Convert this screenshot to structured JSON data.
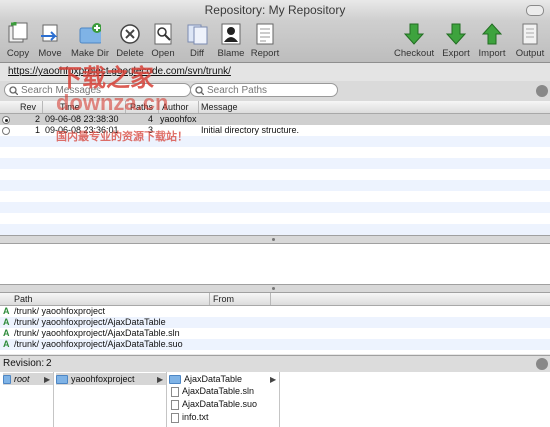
{
  "window": {
    "title": "Repository: My Repository"
  },
  "toolbar": {
    "left": [
      {
        "label": "Copy",
        "icon": "copy-icon"
      },
      {
        "label": "Move",
        "icon": "move-icon"
      },
      {
        "label": "Make Dir",
        "icon": "make-dir-icon"
      },
      {
        "label": "Delete",
        "icon": "delete-icon"
      },
      {
        "label": "Open",
        "icon": "open-icon"
      },
      {
        "label": "Diff",
        "icon": "diff-icon"
      },
      {
        "label": "Blame",
        "icon": "blame-icon"
      },
      {
        "label": "Report",
        "icon": "report-icon"
      }
    ],
    "right": [
      {
        "label": "Checkout",
        "icon": "checkout-icon"
      },
      {
        "label": "Export",
        "icon": "export-icon"
      },
      {
        "label": "Import",
        "icon": "import-icon"
      },
      {
        "label": "Output",
        "icon": "output-icon"
      }
    ]
  },
  "repo_url": "https://yaoohfoxproject.googlecode.com/svn/trunk/",
  "search": {
    "messages_placeholder": "Search Messages",
    "paths_placeholder": "Search Paths"
  },
  "log": {
    "columns": [
      "Rev",
      "Time",
      "Paths",
      "Author",
      "Message"
    ],
    "rows": [
      {
        "rev": "2",
        "time": "09-06-08 23:38:30",
        "paths": "4",
        "author": "yaoohfox",
        "message": "",
        "selected": true
      },
      {
        "rev": "1",
        "time": "09-06-08 23:36:01",
        "paths": "3",
        "author": "",
        "message": "Initial directory structure.",
        "selected": false
      }
    ]
  },
  "paths": {
    "columns": [
      "Path",
      "From"
    ],
    "rows": [
      {
        "action": "A",
        "path": "/trunk/ yaoohfoxproject"
      },
      {
        "action": "A",
        "path": "/trunk/ yaoohfoxproject/AjaxDataTable"
      },
      {
        "action": "A",
        "path": "/trunk/ yaoohfoxproject/AjaxDataTable.sln"
      },
      {
        "action": "A",
        "path": "/trunk/ yaoohfoxproject/AjaxDataTable.suo"
      }
    ]
  },
  "revision": {
    "label": "Revision:",
    "value": "2"
  },
  "browser": {
    "col1": [
      "root"
    ],
    "col2": [
      "yaoohfoxproject"
    ],
    "col3": [
      "AjaxDataTable",
      "AjaxDataTable.sln",
      "AjaxDataTable.suo",
      "info.txt"
    ]
  },
  "watermark": {
    "line1": "下载之家",
    "line2": "downza.cn",
    "line3": "国内最专业的资源下载站！"
  }
}
